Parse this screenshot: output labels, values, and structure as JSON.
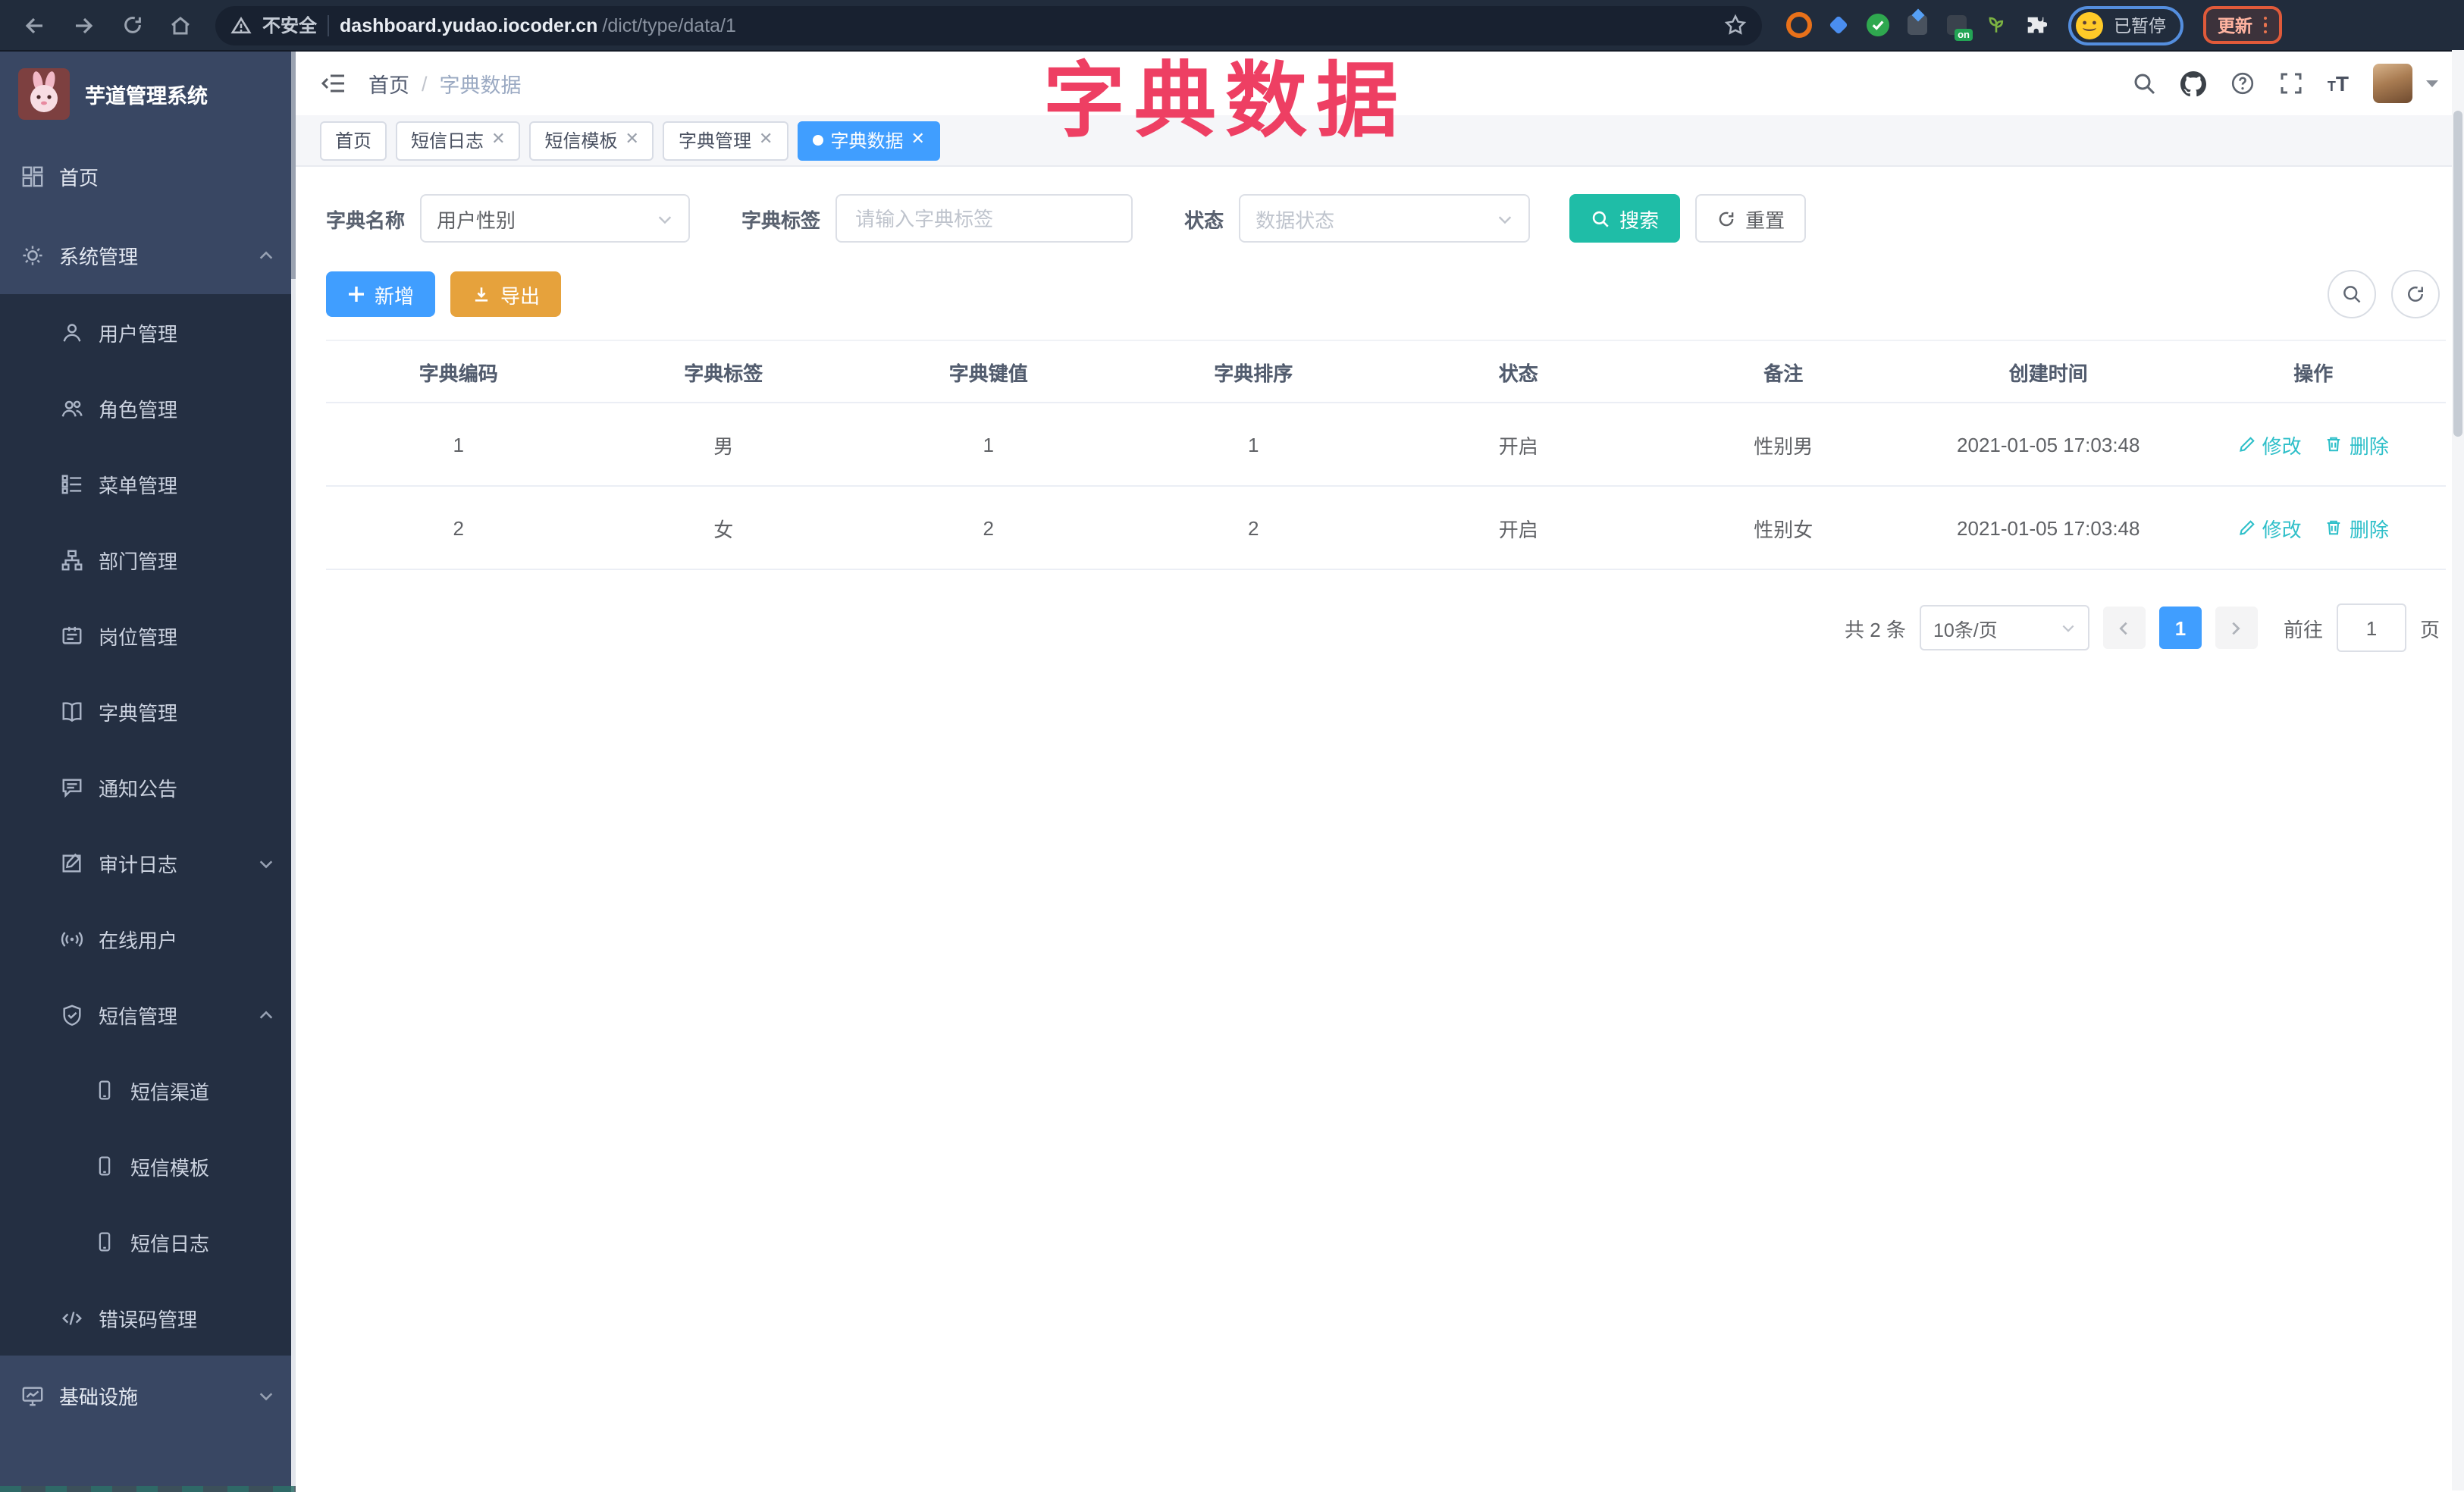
{
  "browser": {
    "security_label": "不安全",
    "url_host": "dashboard.yudao.iocoder.cn",
    "url_path": "/dict/type/data/1",
    "profile_paused_label": "已暂停",
    "update_label": "更新",
    "extension_on_badge": "on"
  },
  "overlay_title": "字典数据",
  "sidebar": {
    "logo_title": "芋道管理系统",
    "home": "首页",
    "system": "系统管理",
    "users": "用户管理",
    "roles": "角色管理",
    "menus": "菜单管理",
    "depts": "部门管理",
    "posts": "岗位管理",
    "dicts": "字典管理",
    "notices": "通知公告",
    "audit": "审计日志",
    "online": "在线用户",
    "sms": "短信管理",
    "sms_channel": "短信渠道",
    "sms_template": "短信模板",
    "sms_log": "短信日志",
    "errcode": "错误码管理",
    "infra": "基础设施"
  },
  "navbar": {
    "breadcrumb_home": "首页",
    "breadcrumb_sep": "/",
    "breadcrumb_current": "字典数据"
  },
  "tabs": {
    "t0": "首页",
    "t1": "短信日志",
    "t2": "短信模板",
    "t3": "字典管理",
    "t4": "字典数据"
  },
  "filters": {
    "name_label": "字典名称",
    "name_value": "用户性别",
    "tag_label": "字典标签",
    "tag_placeholder": "请输入字典标签",
    "status_label": "状态",
    "status_placeholder": "数据状态",
    "search_label": "搜索",
    "reset_label": "重置"
  },
  "toolbar": {
    "add_label": "新增",
    "export_label": "导出"
  },
  "table": {
    "headers": [
      "字典编码",
      "字典标签",
      "字典键值",
      "字典排序",
      "状态",
      "备注",
      "创建时间",
      "操作"
    ],
    "rows": [
      {
        "code": "1",
        "label": "男",
        "value": "1",
        "sort": "1",
        "status": "开启",
        "remark": "性别男",
        "created": "2021-01-05 17:03:48"
      },
      {
        "code": "2",
        "label": "女",
        "value": "2",
        "sort": "2",
        "status": "开启",
        "remark": "性别女",
        "created": "2021-01-05 17:03:48"
      }
    ],
    "edit_label": "修改",
    "delete_label": "删除"
  },
  "pagination": {
    "total": "共 2 条",
    "page_size": "10条/页",
    "page": "1",
    "goto_label": "前往",
    "goto_value": "1",
    "unit_label": "页"
  },
  "colors": {
    "primary_blue": "#409eff",
    "warning_orange": "#e6a23c",
    "search_teal": "#1fbda7",
    "link_teal": "#2ebfc9",
    "annotation_pink": "#ee3f63",
    "sidebar_bg": "#394763",
    "submenu_bg": "#242f42",
    "browser_bar_bg": "#212c3c"
  }
}
